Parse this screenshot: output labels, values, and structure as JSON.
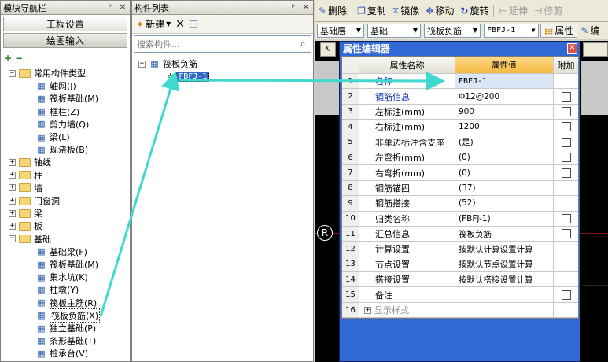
{
  "left_panel": {
    "title": "模块导航栏",
    "pin": "ᵖ",
    "close": "✕",
    "btn_project": "工程设置",
    "btn_draw": "绘图输入",
    "add_icon": "+",
    "minus_icon": "−",
    "tree": [
      {
        "label": "常用构件类型",
        "kind": "folder",
        "pm": "−"
      },
      {
        "label": "轴网(J)",
        "kind": "comp"
      },
      {
        "label": "筏板基础(M)",
        "kind": "comp"
      },
      {
        "label": "框柱(Z)",
        "kind": "comp"
      },
      {
        "label": "剪力墙(Q)",
        "kind": "comp"
      },
      {
        "label": "梁(L)",
        "kind": "comp"
      },
      {
        "label": "现浇板(B)",
        "kind": "comp"
      },
      {
        "label": "轴线",
        "kind": "folder",
        "pm": "+"
      },
      {
        "label": "柱",
        "kind": "folder",
        "pm": "+"
      },
      {
        "label": "墙",
        "kind": "folder",
        "pm": "+"
      },
      {
        "label": "门窗洞",
        "kind": "folder",
        "pm": "+"
      },
      {
        "label": "梁",
        "kind": "folder",
        "pm": "+"
      },
      {
        "label": "板",
        "kind": "folder",
        "pm": "+"
      },
      {
        "label": "基础",
        "kind": "folder",
        "pm": "−"
      },
      {
        "label": "基础梁(F)",
        "kind": "comp"
      },
      {
        "label": "筏板基础(M)",
        "kind": "comp"
      },
      {
        "label": "集水坑(K)",
        "kind": "comp"
      },
      {
        "label": "柱墩(Y)",
        "kind": "comp"
      },
      {
        "label": "筏板主筋(R)",
        "kind": "comp"
      },
      {
        "label": "筏板负筋(X)",
        "kind": "comp",
        "selected": true
      },
      {
        "label": "独立基础(P)",
        "kind": "comp"
      },
      {
        "label": "条形基础(T)",
        "kind": "comp"
      },
      {
        "label": "桩承台(V)",
        "kind": "comp"
      }
    ]
  },
  "mid_panel": {
    "title": "构件列表",
    "pin": "ᵖ",
    "close": "✕",
    "new_label": "新建",
    "search_placeholder": "搜索构件...",
    "tree_root": "筏板负筋",
    "tree_item": "FBFJ-1"
  },
  "toolbar1": {
    "delete": "删除",
    "copy": "复制",
    "mirror": "镜像",
    "move": "移动",
    "rotate": "旋转",
    "extend": "延伸",
    "trim": "修剪"
  },
  "toolbar2": {
    "layer": "基础层",
    "category": "基础",
    "type": "筏板负筋",
    "name": "FBFJ-1",
    "attr": "属性",
    "edit": "编"
  },
  "dialog": {
    "title": "属性编辑器",
    "col_name": "属性名称",
    "col_value": "属性值",
    "col_extra": "附加",
    "rows": [
      {
        "n": "1",
        "name": "名称",
        "value": "FBFJ-1",
        "cb": false,
        "blue": true
      },
      {
        "n": "2",
        "name": "钢筋信息",
        "value": "Φ12@200",
        "cb": true,
        "blue": true
      },
      {
        "n": "3",
        "name": "左标注(mm)",
        "value": "900",
        "cb": true
      },
      {
        "n": "4",
        "name": "右标注(mm)",
        "value": "1200",
        "cb": true
      },
      {
        "n": "5",
        "name": "非单边标注含支座",
        "value": "(是)",
        "cb": true
      },
      {
        "n": "6",
        "name": "左弯折(mm)",
        "value": "(0)",
        "cb": true
      },
      {
        "n": "7",
        "name": "右弯折(mm)",
        "value": "(0)",
        "cb": true
      },
      {
        "n": "8",
        "name": "钢筋锚固",
        "value": "(37)",
        "cb": false
      },
      {
        "n": "9",
        "name": "钢筋搭接",
        "value": "(52)",
        "cb": false
      },
      {
        "n": "10",
        "name": "归类名称",
        "value": "(FBFJ-1)",
        "cb": true
      },
      {
        "n": "11",
        "name": "汇总信息",
        "value": "筏板负筋",
        "cb": true
      },
      {
        "n": "12",
        "name": "计算设置",
        "value": "按默认计算设置计算",
        "cb": false
      },
      {
        "n": "13",
        "name": "节点设置",
        "value": "按默认节点设置计算",
        "cb": false
      },
      {
        "n": "14",
        "name": "搭接设置",
        "value": "按默认搭接设置计算",
        "cb": false
      },
      {
        "n": "15",
        "name": "备注",
        "value": "",
        "cb": true
      },
      {
        "n": "16",
        "name": "显示样式",
        "value": "",
        "cb": false,
        "gray": true,
        "expander": "+"
      }
    ]
  },
  "canvas": {
    "marker": "R"
  },
  "colors": {
    "accent": "#3168d5",
    "arrow": "#3fd9d0",
    "selection": "#316ac5"
  }
}
